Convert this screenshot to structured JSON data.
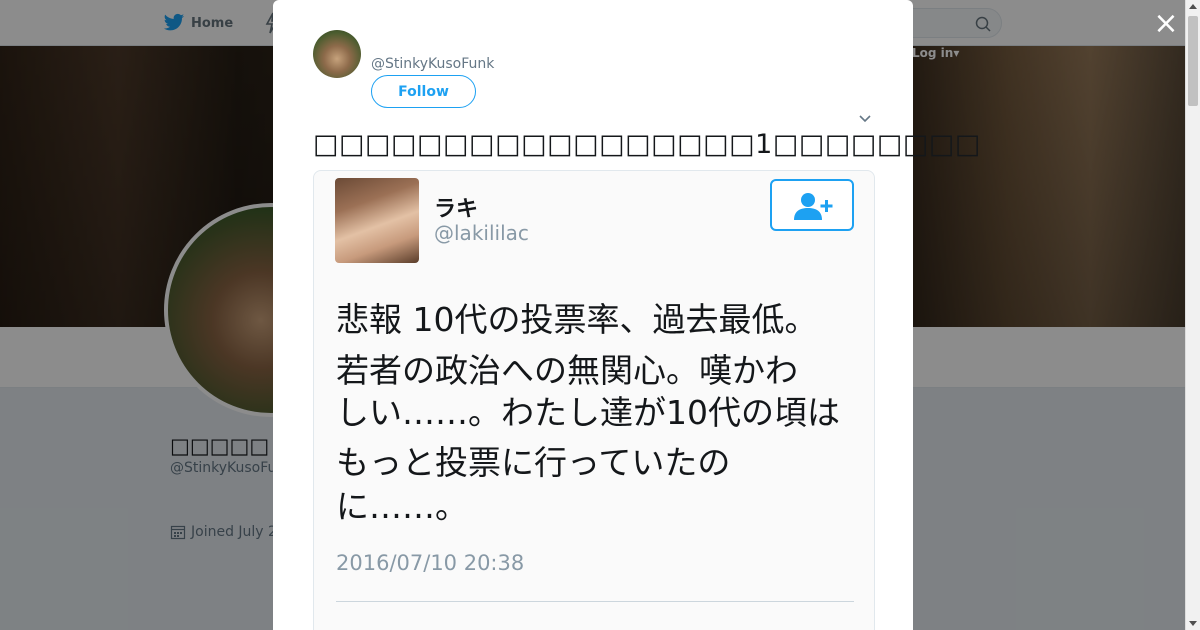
{
  "nav": {
    "home_label": "Home",
    "login_label": "Log in"
  },
  "background_profile": {
    "name": "□□□□□",
    "handle": "@StinkyKusoFunk",
    "joined": "Joined July 2"
  },
  "modal": {
    "close_glyph": "×",
    "author_handle": "@StinkyKusoFunk",
    "follow_label": "Follow",
    "tweet_text": "□□□□□□□□□□□□□□□□□1□□□□□□□□",
    "embedded": {
      "display_name": "ラキ",
      "handle": "@lakililac",
      "body_lines": [
        "悲報 10代の投票率、過去最低。",
        "若者の政治への無関心。嘆かわ",
        "しい……。わたし達が10代の頃は",
        "もっと投票に行っていたの",
        "に……。"
      ],
      "date": "2016/07/10 20:38"
    }
  },
  "colors": {
    "brand_blue": "#1da1f2",
    "text_primary": "#14171a",
    "text_secondary": "#657786",
    "overlay": "rgba(0,0,0,0.45)"
  },
  "icons": [
    "twitter-bird-icon",
    "moments-icon",
    "search-icon",
    "chevron-down-icon",
    "calendar-icon",
    "close-icon",
    "add-user-icon"
  ]
}
